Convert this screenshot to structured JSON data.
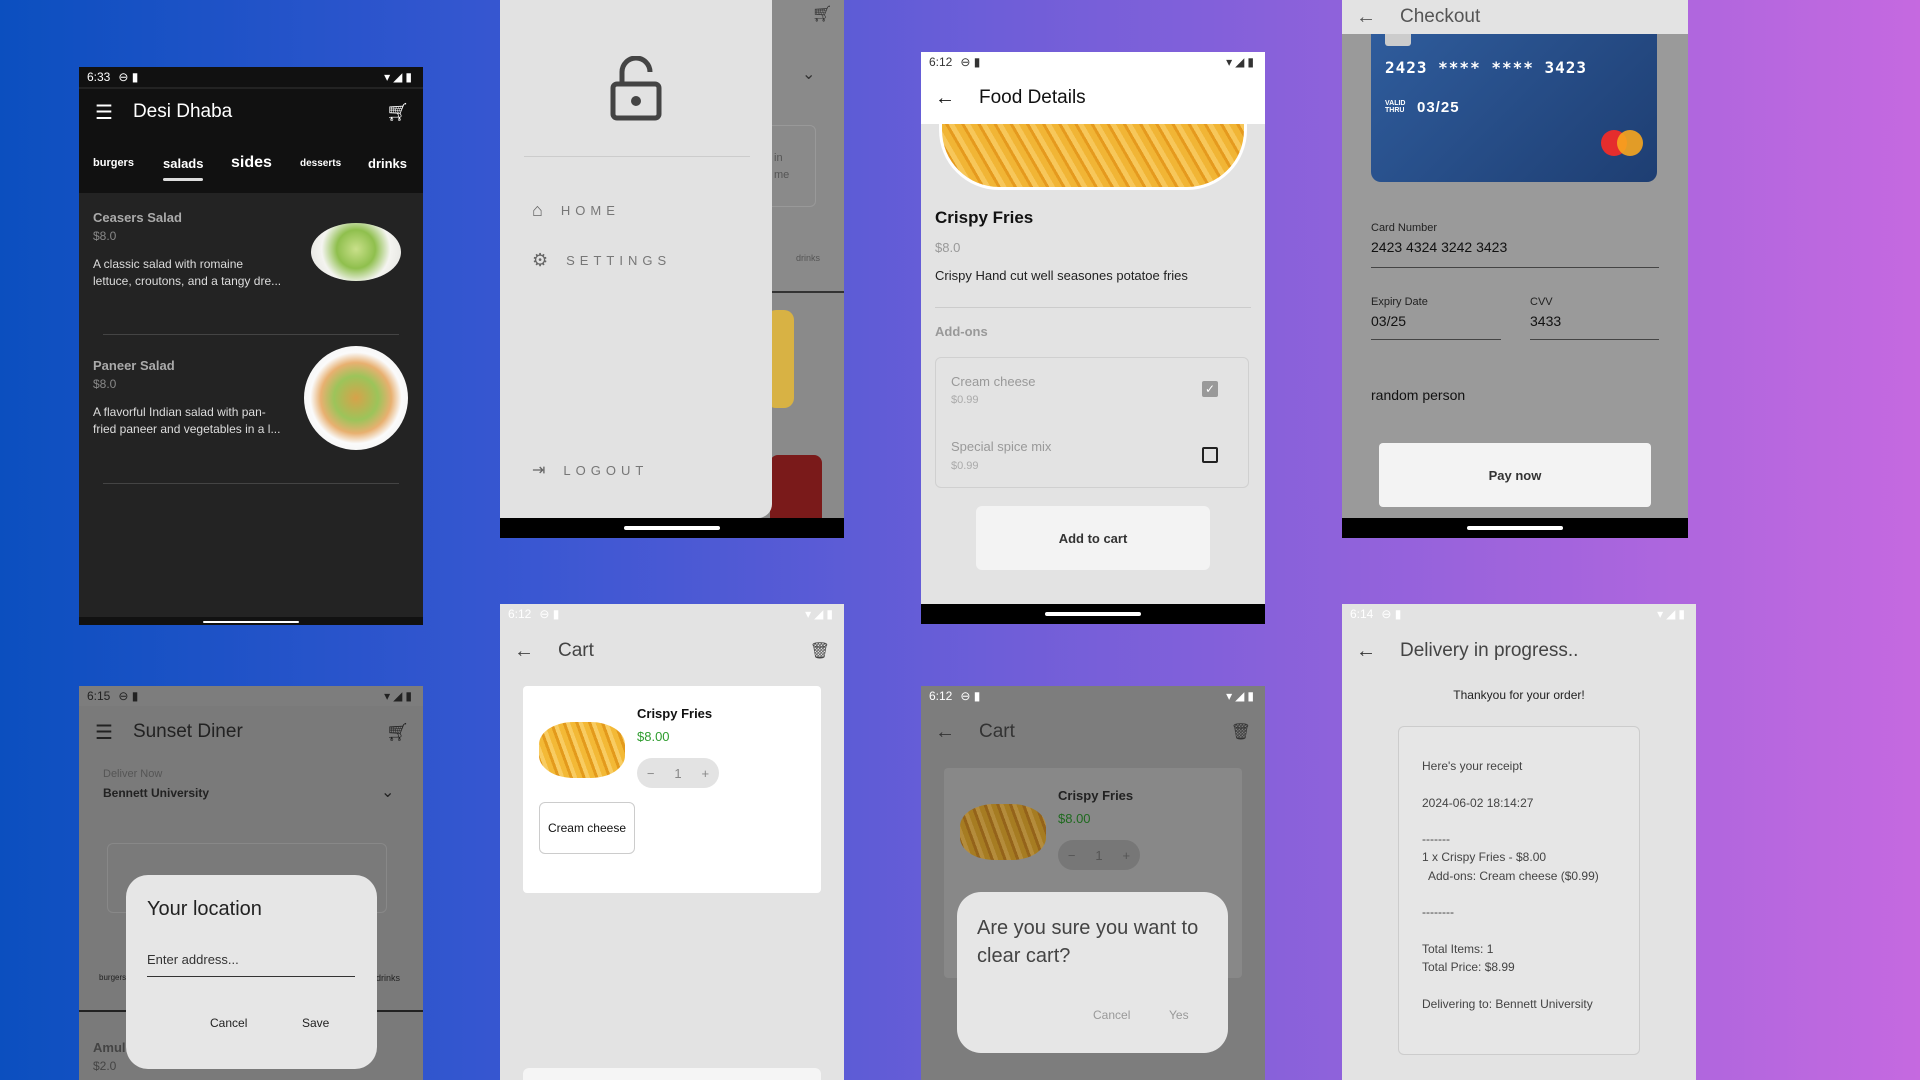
{
  "colors": {
    "accent_green": "#2e9c2e",
    "dark_bg": "#222222",
    "light_bg": "#e3e3e3"
  },
  "screen1": {
    "time": "6:33",
    "title": "Desi Dhaba",
    "tabs": [
      "burgers",
      "salads",
      "sides",
      "desserts",
      "drinks"
    ],
    "items": [
      {
        "name": "Ceasers Salad",
        "price": "$8.0",
        "desc1": "A classic salad with romaine",
        "desc2": "lettuce, croutons, and a tangy dre..."
      },
      {
        "name": "Paneer Salad",
        "price": "$8.0",
        "desc1": "A flavorful Indian salad with pan-",
        "desc2": "fried paneer and vegetables in a l..."
      }
    ]
  },
  "screen2": {
    "menu": [
      "HOME",
      "SETTINGS"
    ],
    "logout": "LOGOUT",
    "bg_text1": "in",
    "bg_text2": "me",
    "bg_tab": "drinks"
  },
  "screen3": {
    "time": "6:12",
    "title": "Food Details",
    "item": "Crispy Fries",
    "price": "$8.0",
    "desc": "Crispy Hand cut well seasones potatoe fries",
    "addons_title": "Add-ons",
    "addons": [
      {
        "name": "Cream cheese",
        "price": "$0.99"
      },
      {
        "name": "Special spice mix",
        "price": "$0.99"
      }
    ],
    "add_button": "Add to cart"
  },
  "screen4": {
    "title": "Checkout",
    "card_masked": "2423 **** **** 3423",
    "valid_thru": "VALID THRU",
    "card_exp": "03/25",
    "card_number_label": "Card Number",
    "card_number": "2423 4324 3242 3423",
    "expiry_label": "Expiry Date",
    "expiry": "03/25",
    "cvv_label": "CVV",
    "cvv": "3433",
    "name": "random person",
    "pay_button": "Pay now"
  },
  "screen5": {
    "time": "6:15",
    "title": "Sunset Diner",
    "deliver_label": "Deliver Now",
    "location": "Bennett University",
    "dialog_title": "Your location",
    "placeholder": "Enter address...",
    "cancel": "Cancel",
    "save": "Save",
    "bg_tab_left": "burgers",
    "bg_tab_right": "drinks",
    "bg_item": "Amul",
    "bg_price": "$2.0"
  },
  "screen6": {
    "time": "6:12",
    "title": "Cart",
    "item": "Crispy Fries",
    "price": "$8.00",
    "qty": "1",
    "addon": "Cream cheese"
  },
  "screen7": {
    "time": "6:12",
    "title": "Cart",
    "item": "Crispy Fries",
    "price": "$8.00",
    "qty": "1",
    "dialog_text": "Are you sure you want to clear cart?",
    "cancel": "Cancel",
    "yes": "Yes"
  },
  "screen8": {
    "time": "6:14",
    "title": "Delivery in progress..",
    "thanks": "Thankyou for your order!",
    "receipt": [
      "Here's your receipt",
      "2024-06-02 18:14:27",
      "-------",
      "1 x Crispy Fries  - $8.00",
      "  Add-ons: Cream cheese ($0.99)",
      "--------",
      "Total Items: 1",
      "Total Price: $8.99",
      "Delivering to: Bennett University"
    ]
  }
}
